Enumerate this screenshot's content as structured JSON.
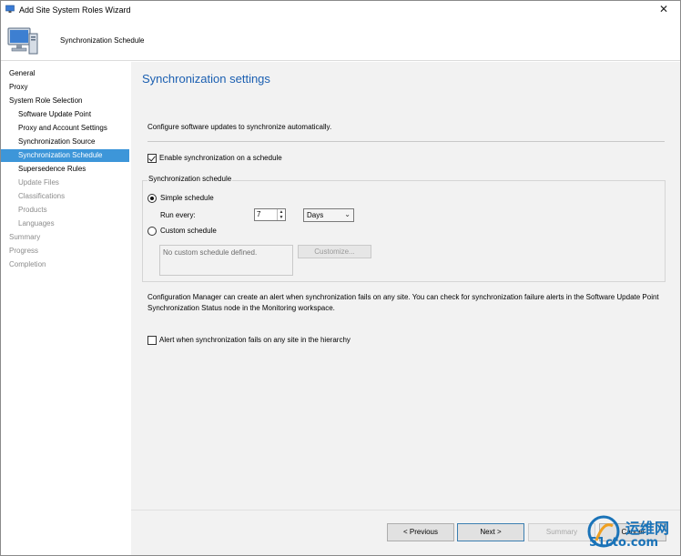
{
  "window": {
    "title": "Add Site System Roles Wizard",
    "close_glyph": "✕"
  },
  "header": {
    "page_title": "Synchronization Schedule"
  },
  "nav": {
    "items": [
      {
        "label": "General",
        "sub": false,
        "state": "normal"
      },
      {
        "label": "Proxy",
        "sub": false,
        "state": "normal"
      },
      {
        "label": "System Role Selection",
        "sub": false,
        "state": "normal"
      },
      {
        "label": "Software Update Point",
        "sub": true,
        "state": "normal"
      },
      {
        "label": "Proxy and Account Settings",
        "sub": true,
        "state": "normal"
      },
      {
        "label": "Synchronization Source",
        "sub": true,
        "state": "normal"
      },
      {
        "label": "Synchronization Schedule",
        "sub": true,
        "state": "active"
      },
      {
        "label": "Supersedence Rules",
        "sub": true,
        "state": "normal"
      },
      {
        "label": "Update Files",
        "sub": true,
        "state": "disabled"
      },
      {
        "label": "Classifications",
        "sub": true,
        "state": "disabled"
      },
      {
        "label": "Products",
        "sub": true,
        "state": "disabled"
      },
      {
        "label": "Languages",
        "sub": true,
        "state": "disabled"
      },
      {
        "label": "Summary",
        "sub": false,
        "state": "disabled"
      },
      {
        "label": "Progress",
        "sub": false,
        "state": "disabled"
      },
      {
        "label": "Completion",
        "sub": false,
        "state": "disabled"
      }
    ]
  },
  "main": {
    "title": "Synchronization settings",
    "intro": "Configure software updates to synchronize automatically.",
    "enable_schedule": {
      "label": "Enable synchronization on a schedule",
      "checked": true
    },
    "schedule_group": {
      "title": "Synchronization schedule",
      "simple": {
        "label": "Simple schedule",
        "selected": true
      },
      "run_every_label": "Run every:",
      "run_every_value": "7",
      "unit": "Days",
      "custom": {
        "label": "Custom schedule",
        "selected": false
      },
      "custom_placeholder": "No custom schedule defined.",
      "customize_button": "Customize..."
    },
    "alert_description": "Configuration Manager can create an alert when synchronization fails on any site. You can check for synchronization failure alerts in the Software Update Point Synchronization Status node in the Monitoring workspace.",
    "alert_checkbox": {
      "label": "Alert when synchronization fails on any site in the hierarchy",
      "checked": false
    }
  },
  "footer": {
    "previous": "< Previous",
    "next": "Next >",
    "summary": "Summary",
    "cancel": "Cancel"
  },
  "watermark": {
    "line1": "运维网",
    "line2": "51cto.com",
    "color": "#1a73b8"
  }
}
